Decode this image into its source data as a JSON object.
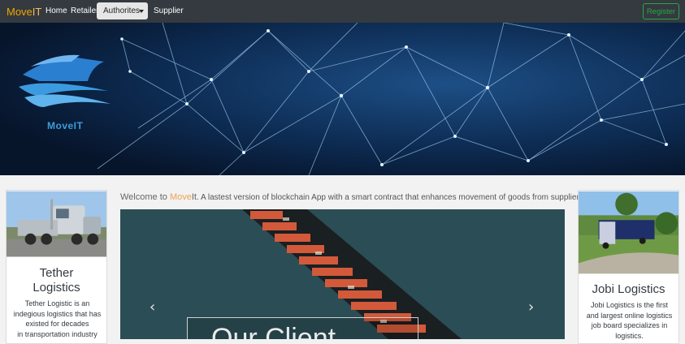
{
  "navbar": {
    "brand_move": "Move",
    "brand_it": "IT",
    "links": [
      "Home",
      "Retailer",
      "Supplier"
    ],
    "dropdown_label": "Authorites",
    "register_label": "Register"
  },
  "hero": {
    "logo_text": "MoveIT"
  },
  "welcome": {
    "prefix": "Welcome to ",
    "brand": "Move",
    "brand_it": "It",
    "message": ". A lastest version of blockchain App with a smart contract that enhances movement of goods from supplier to retailer."
  },
  "carousel": {
    "prev_label": "‹",
    "next_label": "›",
    "caption": "Our Client"
  },
  "cards": {
    "left": {
      "title_line1": "Tether",
      "title_line2": "Logistics",
      "text_lines": [
        "Tether Logistic is an",
        "indegious logistics that has",
        "existed for decades",
        "in transportation industry"
      ]
    },
    "right": {
      "title": "Jobi Logistics",
      "text_lines": [
        "Jobi Logistics is the first",
        "and largest online logistics",
        "job board specializes in",
        "logistics."
      ]
    }
  },
  "colors": {
    "navbar_bg": "#343a40",
    "brand": "#f0a500",
    "register": "#28a745"
  },
  "icons": {
    "prev": "chevron-left-icon",
    "next": "chevron-right-icon",
    "dropdown": "caret-down-icon"
  }
}
